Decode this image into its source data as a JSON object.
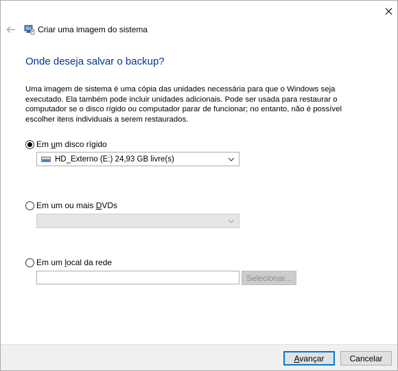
{
  "window": {
    "title": "Criar uma imagem do sistema",
    "close_glyph": "✕",
    "back_icon": "back-arrow-icon"
  },
  "page": {
    "heading": "Onde deseja salvar o backup?",
    "description": "Uma imagem de sistema é uma cópia das unidades necessária para que o Windows seja executado. Ela também pode incluir unidades adicionais. Pode ser usada para restaurar o computador se o disco rígido ou computador parar de funcionar; no entanto, não é possível escolher itens individuais a serem restaurados."
  },
  "options": {
    "hard_disk": {
      "label_pre": "Em ",
      "label_accel": "u",
      "label_post": "m disco rígido",
      "selected": true,
      "drive_value": "HD_Externo (E:)  24,93 GB livre(s)"
    },
    "dvd": {
      "label_pre": "Em um ou mais ",
      "label_accel": "D",
      "label_post": "VDs",
      "selected": false,
      "drive_value": ""
    },
    "network": {
      "label_pre": "Em um ",
      "label_accel": "l",
      "label_post": "ocal da rede",
      "selected": false,
      "path_value": "",
      "select_button_label": "Selecionar..."
    }
  },
  "footer": {
    "next_label_accel": "A",
    "next_label_post": "vançar",
    "cancel_label": "Cancelar"
  },
  "colors": {
    "heading": "#003399",
    "primary_border": "#0078d7",
    "footer_bg": "#f0f0f0"
  }
}
